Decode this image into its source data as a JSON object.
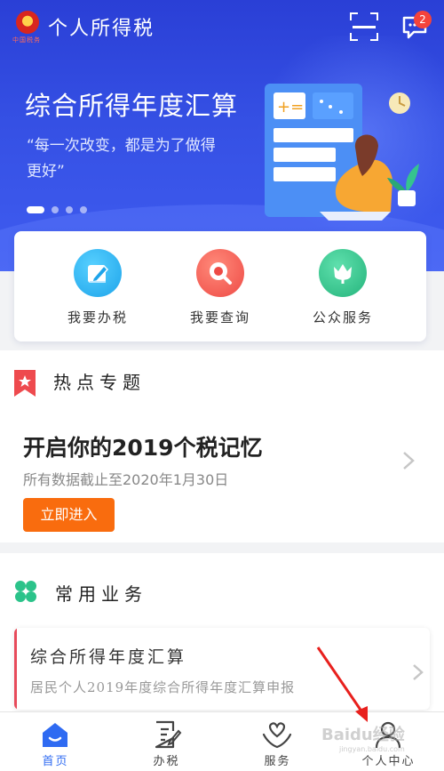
{
  "header": {
    "app_title": "个人所得税",
    "emblem_caption": "中国税务",
    "message_badge_count": "2",
    "icons": {
      "scan": "scan-icon",
      "messages": "message-icon"
    }
  },
  "banner": {
    "title": "综合所得年度汇算",
    "quote": "“每一次改变，都是为了做得更好”",
    "carousel": {
      "total": 4,
      "active": 1
    }
  },
  "quick_actions": [
    {
      "label": "我要办税",
      "icon": "pencil-document-icon",
      "color": "#2fb8ef"
    },
    {
      "label": "我要查询",
      "icon": "magnifier-icon",
      "color": "#f2574f"
    },
    {
      "label": "公众服务",
      "icon": "tulip-icon",
      "color": "#35c48e"
    }
  ],
  "hot_topics": {
    "section_title": "热点专题",
    "headline": "开启你的2019个税记忆",
    "subtext": "所有数据截止至2020年1月30日",
    "button_label": "立即进入",
    "accent_color": "#f96c0e"
  },
  "common_services": {
    "section_title": "常用业务",
    "card_title": "综合所得年度汇算",
    "card_desc": "居民个人2019年度综合所得年度汇算申报"
  },
  "bottom_nav": [
    {
      "label": "首页",
      "icon": "home-icon",
      "active": true
    },
    {
      "label": "办税",
      "icon": "document-icon",
      "active": false
    },
    {
      "label": "服务",
      "icon": "heart-hands-icon",
      "active": false
    },
    {
      "label": "个人中心",
      "icon": "user-icon",
      "active": false
    }
  ],
  "colors": {
    "primary": "#3550e4",
    "nav_active": "#2f6bf2",
    "annotation": "#e8201d"
  },
  "watermark": {
    "text": "Baidu经验",
    "sub": "jingyan.baidu.com"
  }
}
